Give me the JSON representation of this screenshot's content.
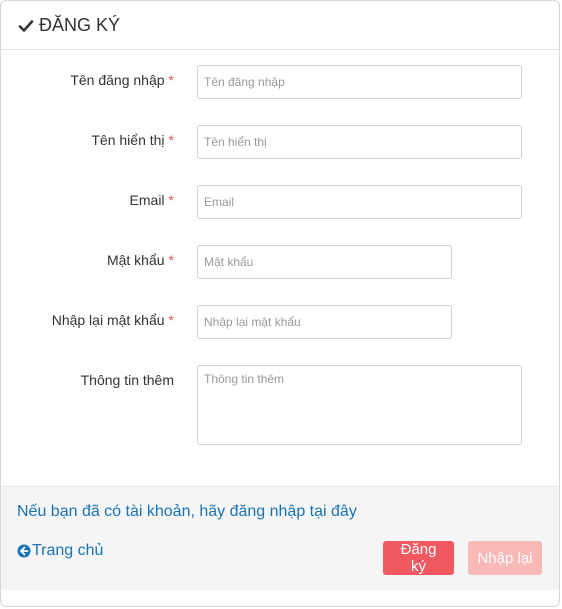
{
  "header": {
    "title": "ĐĂNG KÝ",
    "icon": "check-icon"
  },
  "form": {
    "required_mark": "*",
    "fields": [
      {
        "label": "Tên đăng nhập",
        "placeholder": "Tên đăng nhập",
        "value": ""
      },
      {
        "label": "Tên hiển thị",
        "placeholder": "Tên hiển thị",
        "value": ""
      },
      {
        "label": "Email",
        "placeholder": "Email",
        "value": ""
      },
      {
        "label": "Mật khẩu",
        "placeholder": "Mật khẩu",
        "value": ""
      },
      {
        "label": "Nhập lại mật khẩu",
        "placeholder": "Nhập lại mật khẩu",
        "value": ""
      },
      {
        "label": "Thông tin thêm",
        "placeholder": "Thông tin thêm",
        "value": ""
      }
    ]
  },
  "footer": {
    "login_link": "Nếu bạn đã có tài khoản, hãy đăng nhập tại đây",
    "home_link": "Trang chủ",
    "home_icon": "arrow-circle-left-icon",
    "register_button": "Đăng ký",
    "reset_button": "Nhập lại"
  },
  "colors": {
    "link": "#1a73b5",
    "required": "#d9534f",
    "register_button": "#f0595f",
    "reset_button": "#f8b9b7"
  }
}
